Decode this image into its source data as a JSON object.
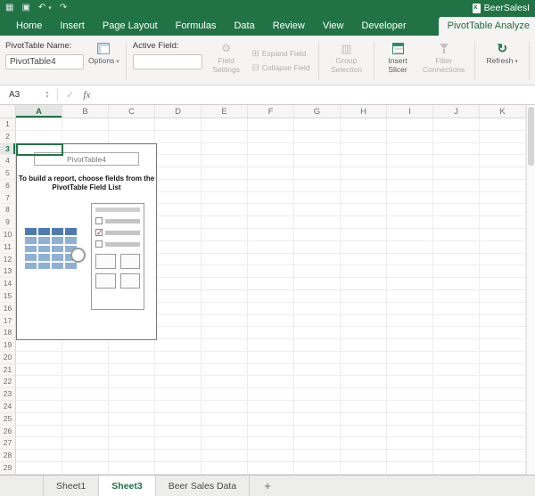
{
  "colors": {
    "excel_green": "#217346",
    "active_tab_text": "#1e6b41",
    "disabled_text": "#b3afac",
    "icon_blue": "#7a9cc6",
    "slicer_teal": "#2e8b6f"
  },
  "icons": {
    "app": "▦",
    "save": "▣",
    "undo": "↶",
    "redo": "↷",
    "caret_down": "▾",
    "spinner_up": "▴",
    "spinner_down": "▾",
    "check": "✓",
    "gear": "⚙",
    "expand": "⊞",
    "collapse": "⊟",
    "group": "▥",
    "refresh": "↻",
    "pivot_check": "✓"
  },
  "window": {
    "document_title": "BeerSalesI"
  },
  "ribbon_tabs": {
    "items": [
      {
        "label": "Home",
        "active": false
      },
      {
        "label": "Insert",
        "active": false
      },
      {
        "label": "Page Layout",
        "active": false
      },
      {
        "label": "Formulas",
        "active": false
      },
      {
        "label": "Data",
        "active": false
      },
      {
        "label": "Review",
        "active": false
      },
      {
        "label": "View",
        "active": false
      },
      {
        "label": "Developer",
        "active": false
      },
      {
        "label": "PivotTable Analyze",
        "active": true
      }
    ]
  },
  "ribbon": {
    "pivot_name_label": "PivotTable Name:",
    "pivot_name_value": "PivotTable4",
    "options_label": "Options",
    "active_field_label": "Active Field:",
    "active_field_value": "",
    "field_settings_label": "Field Settings",
    "expand_field_label": "Expand Field",
    "collapse_field_label": "Collapse Field",
    "group_selection_label": "Group Selection",
    "insert_slicer_label": "Insert Slicer",
    "filter_connections_label": "Filter Connections",
    "refresh_label": "Refresh"
  },
  "formula_bar": {
    "name_box_value": "A3",
    "fx_label": "fx"
  },
  "grid": {
    "columns": [
      "A",
      "B",
      "C",
      "D",
      "E",
      "F",
      "G",
      "H",
      "I",
      "J",
      "K"
    ],
    "row_count": 29,
    "selected_column": "A",
    "selected_row": 3,
    "selected_cell": "A3"
  },
  "pivot_placeholder": {
    "title": "PivotTable4",
    "instruction_line1": "To build a report, choose fields from the",
    "instruction_line2": "PivotTable Field List"
  },
  "sheet_bar": {
    "tabs": [
      {
        "label": "Sheet1",
        "active": false
      },
      {
        "label": "Sheet3",
        "active": true
      },
      {
        "label": "Beer Sales Data",
        "active": false
      }
    ],
    "add_label": "+"
  }
}
